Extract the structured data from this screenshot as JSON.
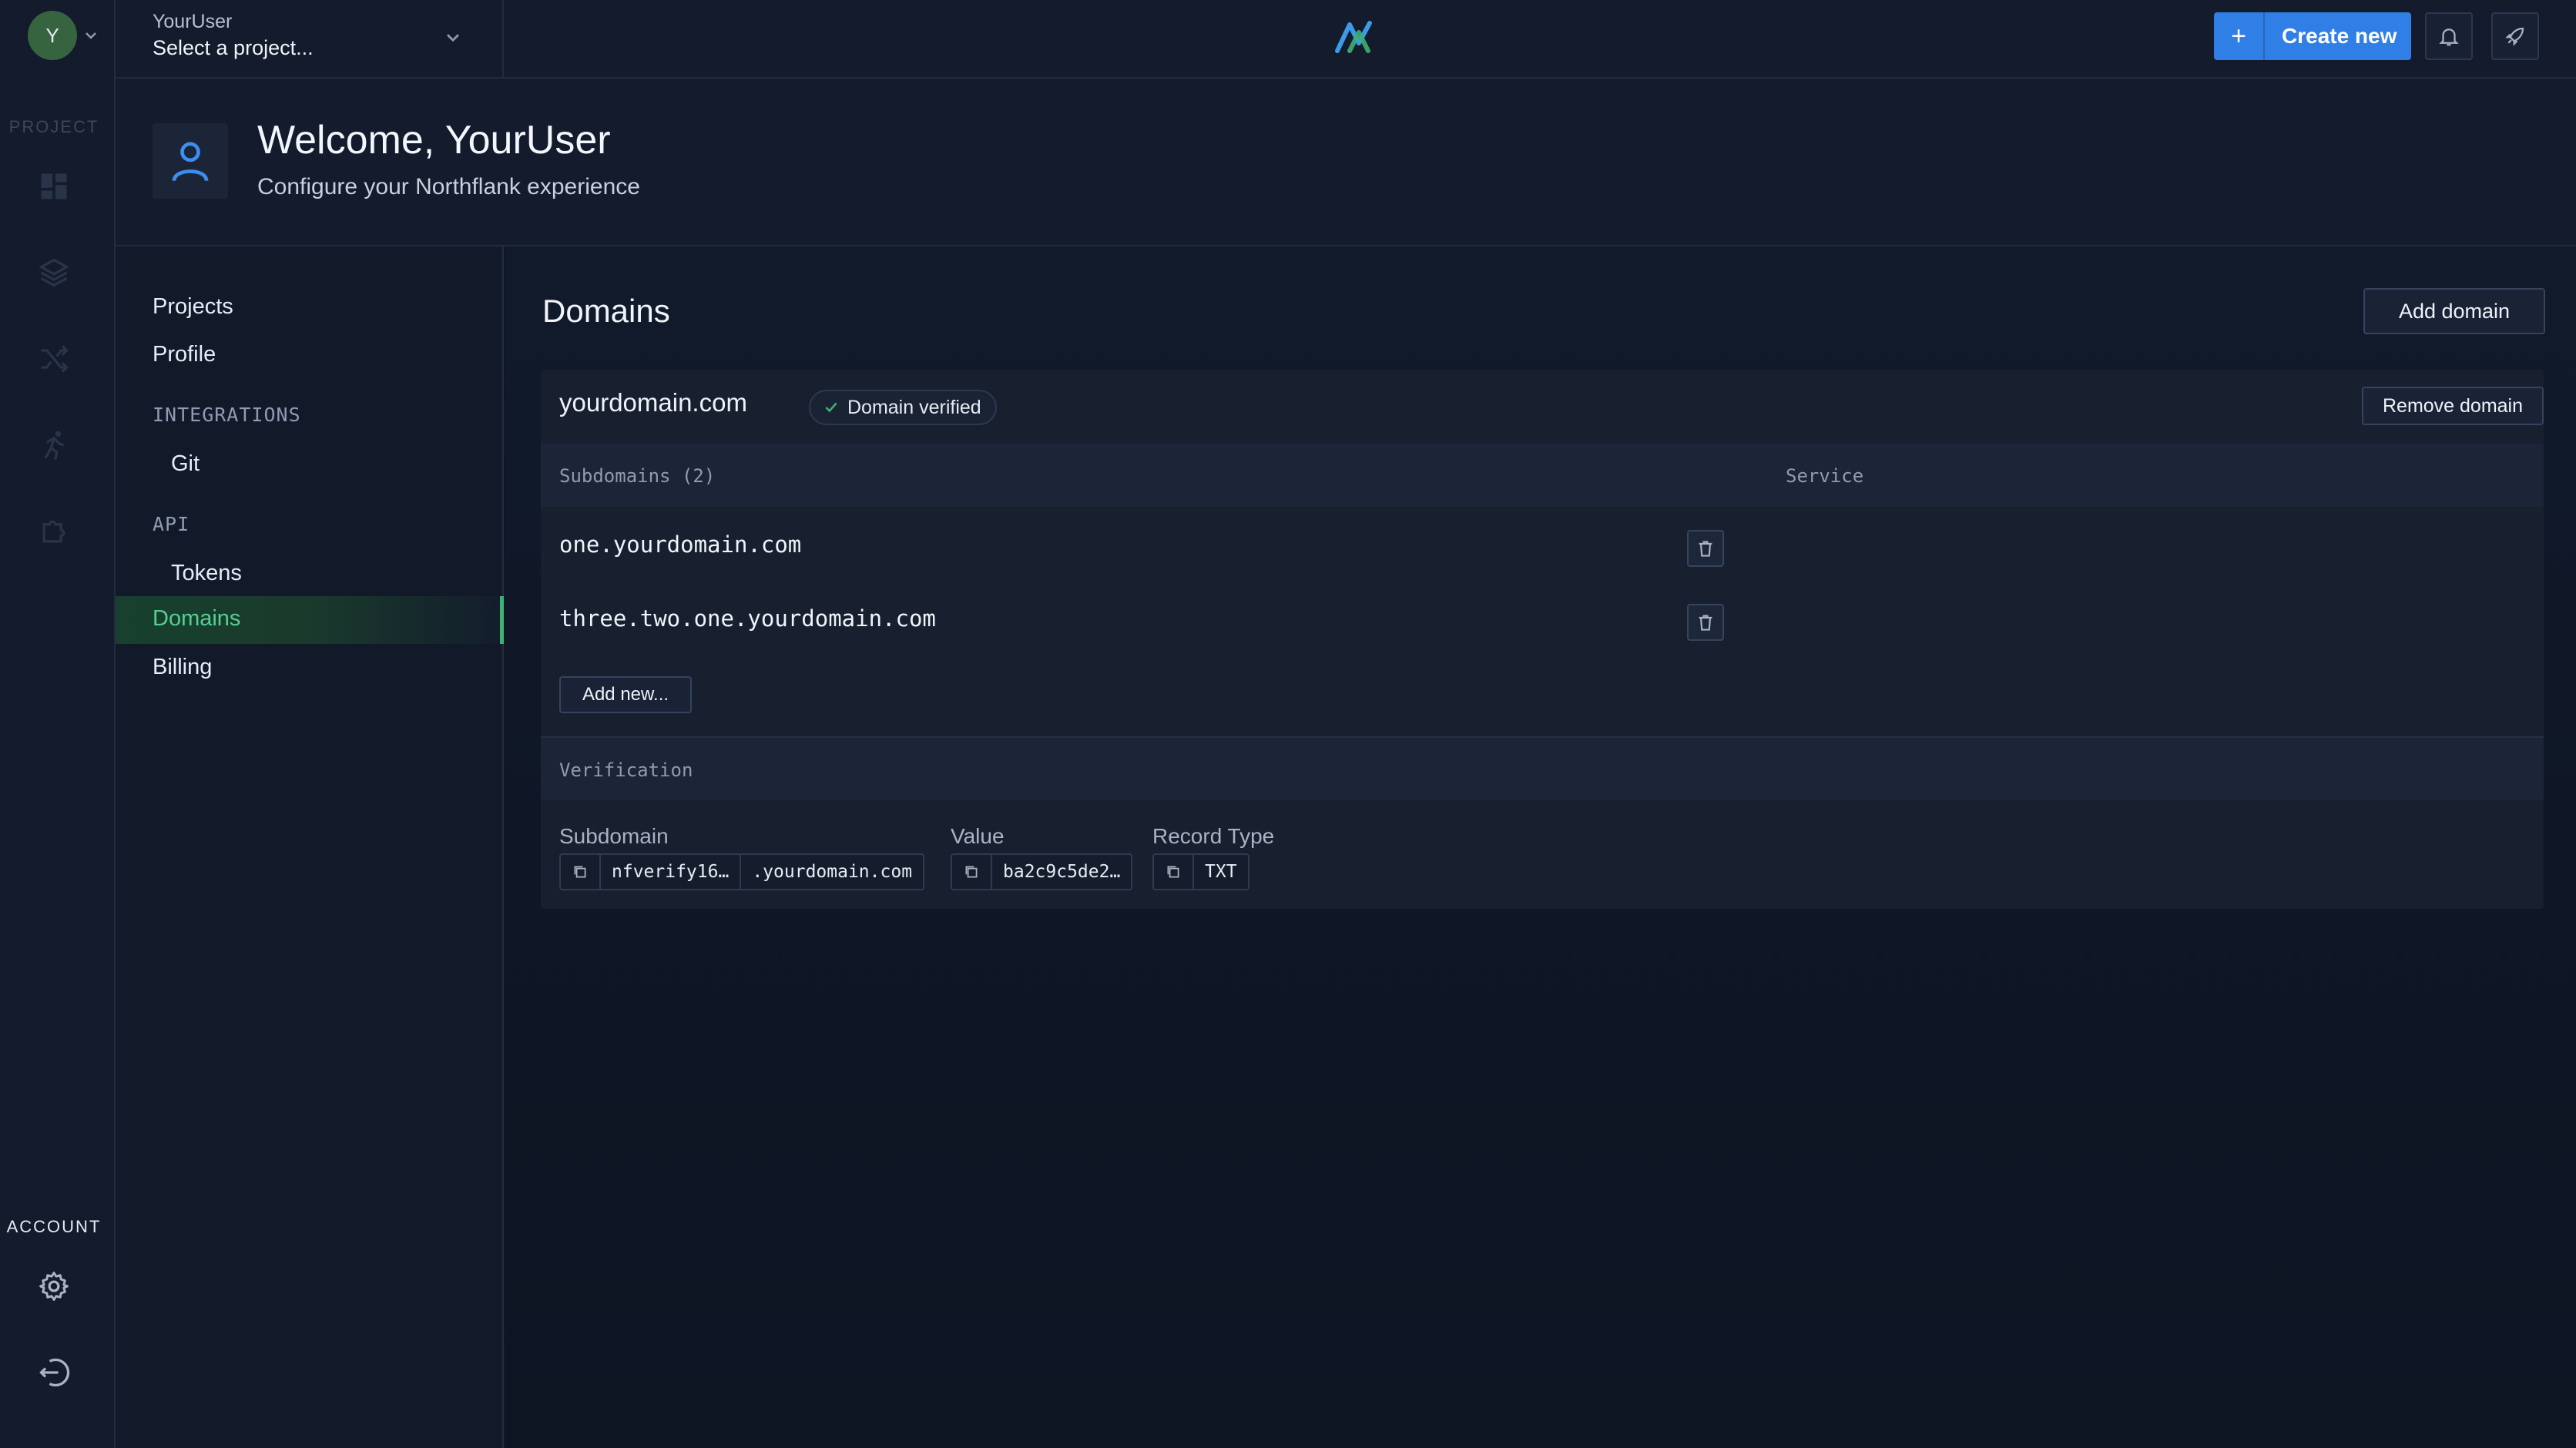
{
  "rail": {
    "avatar_initial": "Y",
    "project_label": "PROJECT",
    "account_label": "ACCOUNT",
    "icons": [
      "dashboard-icon",
      "layers-icon",
      "shuffle-icon",
      "run-icon",
      "puzzle-icon",
      "gear-icon",
      "logout-icon"
    ]
  },
  "topbar": {
    "user": "YourUser",
    "project_placeholder": "Select a project...",
    "create_label": "Create new",
    "create_plus": "+"
  },
  "welcome": {
    "title": "Welcome, YourUser",
    "subtitle": "Configure your Northflank experience"
  },
  "nav": {
    "projects": "Projects",
    "profile": "Profile",
    "integrations": "INTEGRATIONS",
    "git": "Git",
    "api": "API",
    "tokens": "Tokens",
    "domains": "Domains",
    "billing": "Billing"
  },
  "main": {
    "title": "Domains",
    "add_domain": "Add domain",
    "domain": {
      "name": "yourdomain.com",
      "badge": "Domain verified",
      "remove": "Remove domain",
      "subdomains_header": "Subdomains (2)",
      "service_header": "Service",
      "subdomains": [
        "one.yourdomain.com",
        "three.two.one.yourdomain.com"
      ],
      "add_new": "Add new...",
      "verification_header": "Verification",
      "verification": {
        "subdomain_label": "Subdomain",
        "subdomain_value": "nfverify16…",
        "subdomain_suffix": ".yourdomain.com",
        "value_label": "Value",
        "value": "ba2c9c5de2…",
        "record_type_label": "Record Type",
        "record_type": "TXT"
      }
    }
  },
  "colors": {
    "accent": "#2f7fe6",
    "active_nav": "#55d08e",
    "avatar": "#35643f"
  }
}
